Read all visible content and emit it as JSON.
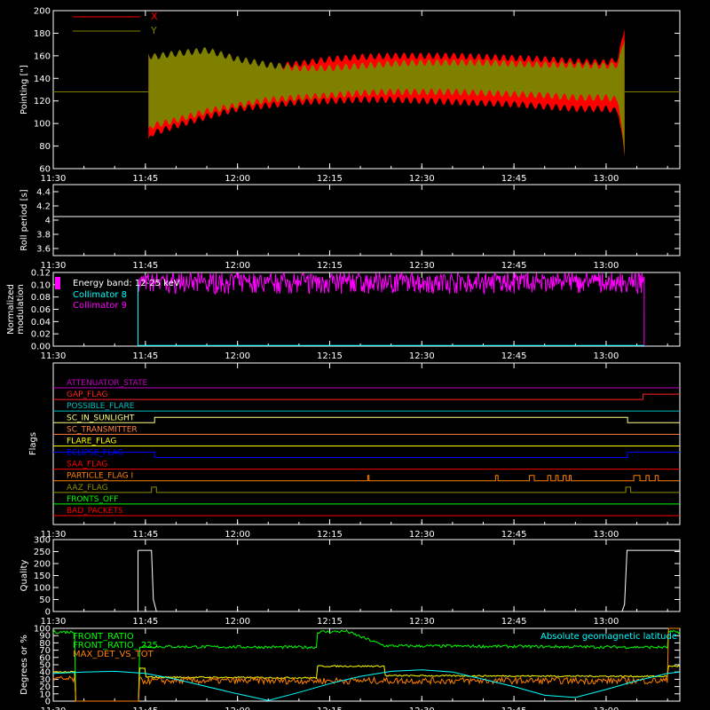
{
  "colors": {
    "background": "#000000",
    "axis": "#ffffff",
    "pointing_x": "#ff0000",
    "pointing_y": "#808000",
    "roll": "#ffffff",
    "collimator_8": "#00ffff",
    "collimator_9": "#ff00ff",
    "quality": "#ffffff",
    "front_ratio": "#00ff00",
    "front_ratio_225": "#ffff00",
    "max_det_vs_tot": "#ff8000",
    "geomag_lat": "#00ffff"
  },
  "time_axis": {
    "min_minutes": 690,
    "max_minutes": 792,
    "ticks": [
      {
        "value": 690,
        "label": "11:30"
      },
      {
        "value": 705,
        "label": "11:45"
      },
      {
        "value": 720,
        "label": "12:00"
      },
      {
        "value": 735,
        "label": "12:15"
      },
      {
        "value": 750,
        "label": "12:30"
      },
      {
        "value": 765,
        "label": "12:45"
      },
      {
        "value": 780,
        "label": "13:00"
      }
    ]
  },
  "chart_data": [
    {
      "type": "area",
      "ylabel": "Pointing [\"]",
      "ylim": [
        60,
        200
      ],
      "yticks": [
        60,
        80,
        100,
        120,
        140,
        160,
        180,
        200
      ],
      "legend": [
        "X",
        "Y"
      ],
      "series": [
        {
          "name": "X",
          "x": [
            705.5,
            706,
            710,
            715,
            720,
            725,
            730,
            735,
            740,
            745,
            750,
            755,
            760,
            765,
            770,
            775,
            780,
            782,
            783
          ],
          "upper": [
            165,
            155,
            150,
            150,
            150,
            153,
            156,
            160,
            162,
            163,
            163,
            163,
            162,
            161,
            160,
            158,
            157,
            160,
            190
          ],
          "lower": [
            80,
            88,
            95,
            103,
            110,
            113,
            116,
            117,
            118,
            118,
            117,
            116,
            115,
            114,
            112,
            110,
            110,
            108,
            68
          ]
        },
        {
          "name": "Y",
          "x": [
            705.5,
            706,
            710,
            715,
            720,
            725,
            730,
            735,
            740,
            745,
            750,
            755,
            760,
            765,
            770,
            775,
            780,
            782,
            783
          ],
          "upper": [
            165,
            162,
            165,
            168,
            160,
            155,
            152,
            152,
            154,
            156,
            157,
            157,
            157,
            156,
            155,
            155,
            154,
            155,
            180
          ],
          "lower": [
            90,
            95,
            100,
            108,
            113,
            118,
            120,
            122,
            124,
            125,
            125,
            125,
            124,
            123,
            122,
            120,
            120,
            118,
            68
          ]
        },
        {
          "name": "constant",
          "x": [
            690,
            705.5
          ],
          "value": 128
        },
        {
          "name": "constant_right",
          "x": [
            783,
            792
          ],
          "value": 128
        }
      ]
    },
    {
      "type": "line",
      "ylabel": "Roll period [s]",
      "ylim": [
        3.5,
        4.5
      ],
      "yticks": [
        3.6,
        3.8,
        4.0,
        4.2,
        4.4
      ],
      "series": [
        {
          "name": "roll",
          "x": [
            690,
            792
          ],
          "y": [
            4.05,
            4.05
          ]
        }
      ]
    },
    {
      "type": "line",
      "ylabel": "Normalized modulation",
      "ylim": [
        0,
        0.12
      ],
      "yticks": [
        0.0,
        0.02,
        0.04,
        0.06,
        0.08,
        0.1,
        0.12
      ],
      "ytick_labels": [
        "0.00",
        "0.02",
        "0.04",
        "0.06",
        "0.08",
        "0.10",
        "0.12"
      ],
      "annotation": "Energy band: 12-25 keV",
      "series": [
        {
          "name": "Collimator 8",
          "start": 703.8,
          "end": 786.2,
          "level": 0.0
        },
        {
          "name": "Collimator 9",
          "start": 703.8,
          "end": 786.2,
          "low": 0.085,
          "high": 0.12
        }
      ]
    },
    {
      "type": "table",
      "ylabel": "Flags",
      "flags": [
        {
          "name": "ATTENUATOR_STATE",
          "color": "#c000c0",
          "steps": []
        },
        {
          "name": "GAP_FLAG",
          "color": "#ff2020",
          "steps": [
            [
              786,
              1
            ]
          ]
        },
        {
          "name": "POSSIBLE_FLARE",
          "color": "#00c0c0",
          "steps": []
        },
        {
          "name": "SC_IN_SUNLIGHT",
          "color": "#ffff80",
          "steps": [
            [
              706.5,
              1
            ],
            [
              783.5,
              0
            ]
          ]
        },
        {
          "name": "SC_TRANSMITTER",
          "color": "#ff8040",
          "steps": []
        },
        {
          "name": "FLARE_FLAG",
          "color": "#ffff00",
          "steps": []
        },
        {
          "name": "ECLIPSE_FLAG",
          "color": "#0000ff",
          "steps": [
            [
              706.5,
              0
            ],
            [
              783.5,
              1
            ]
          ],
          "initial": 1
        },
        {
          "name": "SAA_FLAG",
          "color": "#ff0000",
          "steps": []
        },
        {
          "name": "PARTICLE_FLAG I",
          "color": "#ff8000",
          "pulses": [
            [
              741.2,
              741.4
            ],
            [
              762.0,
              762.4
            ],
            [
              767.5,
              768.3
            ],
            [
              770.5,
              771.0
            ],
            [
              771.8,
              772.2
            ],
            [
              773.0,
              773.5
            ],
            [
              774.0,
              774.3
            ],
            [
              784.5,
              785.5
            ],
            [
              786.5,
              787.0
            ],
            [
              788.0,
              788.5
            ]
          ]
        },
        {
          "name": "AAZ_FLAG",
          "color": "#909000",
          "pulses": [
            [
              706,
              706.8
            ],
            [
              783.2,
              784.0
            ]
          ]
        },
        {
          "name": "FRONTS_OFF",
          "color": "#00ff00",
          "steps": []
        },
        {
          "name": "BAD_PACKETS",
          "color": "#ff0000",
          "steps": []
        }
      ]
    },
    {
      "type": "line",
      "ylabel": "Quality",
      "ylim": [
        0,
        300
      ],
      "yticks": [
        0,
        50,
        100,
        150,
        200,
        250,
        300
      ],
      "series": [
        {
          "name": "quality",
          "x": [
            703.8,
            706.0,
            706.3,
            706.8,
            782.6,
            783.0,
            783.4,
            792
          ],
          "y": [
            255,
            255,
            50,
            0,
            0,
            30,
            255,
            255
          ]
        }
      ]
    },
    {
      "type": "line",
      "ylabel": "Degrees or %",
      "ylim": [
        0,
        100
      ],
      "yticks": [
        0,
        10,
        20,
        30,
        40,
        50,
        60,
        70,
        80,
        90,
        100
      ],
      "legend": [
        "FRONT_RATIO",
        "FRONT_RATIO_ 225",
        "MAX_DET_VS_TOT",
        "Absolute geomagnetic latitude"
      ],
      "series": [
        {
          "name": "FRONT_RATIO",
          "x": [
            690,
            693.5,
            693.5,
            704,
            704,
            733,
            733,
            738,
            738,
            744,
            744,
            790,
            790,
            792
          ],
          "y": [
            95,
            95,
            0,
            0,
            75,
            74,
            95,
            96,
            95,
            76,
            76,
            74,
            95,
            95
          ]
        },
        {
          "name": "FRONT_RATIO_ 225",
          "x": [
            690,
            693.5,
            693.5,
            704,
            704,
            705,
            705,
            733,
            733,
            744,
            744,
            790,
            790,
            792
          ],
          "y": [
            40,
            40,
            0,
            0,
            45,
            45,
            33,
            32,
            48,
            48,
            35,
            34,
            48,
            48
          ]
        },
        {
          "name": "MAX_DET_VS_TOT",
          "x": [
            690,
            693.5,
            693.5,
            704,
            704,
            790,
            790,
            792
          ],
          "y": [
            30,
            30,
            0,
            0,
            28,
            28,
            100,
            100
          ]
        },
        {
          "name": "Absolute geomagnetic latitude",
          "x": [
            690,
            695,
            700,
            705,
            710,
            715,
            720,
            725,
            730,
            735,
            740,
            745,
            750,
            755,
            760,
            765,
            770,
            775,
            780,
            785,
            790,
            792
          ],
          "y": [
            38,
            40,
            41,
            38,
            30,
            20,
            10,
            1,
            12,
            24,
            34,
            41,
            43,
            40,
            30,
            20,
            8,
            5,
            16,
            28,
            38,
            40
          ]
        }
      ]
    }
  ]
}
